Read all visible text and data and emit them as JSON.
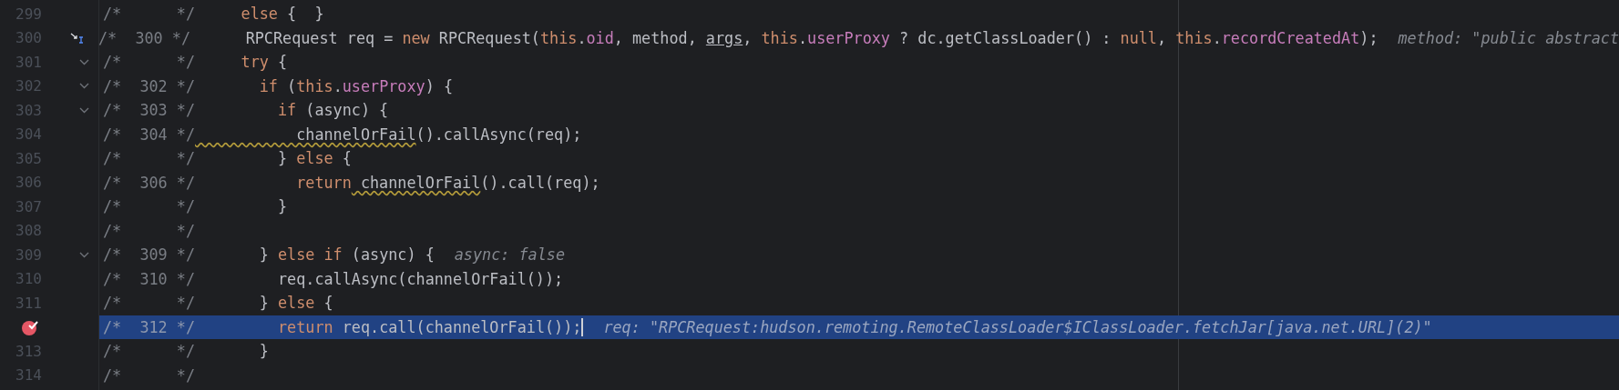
{
  "editor": {
    "rows": [
      {
        "number": "299",
        "foldable": false,
        "stepping": false,
        "breakpoint": false,
        "selected": false,
        "caret": false,
        "prefix": "/*      */",
        "code": [
          {
            "t": "     else",
            "kind": "keyword"
          },
          {
            "t": " {  }",
            "kind": "plain"
          }
        ]
      },
      {
        "number": "300",
        "foldable": false,
        "stepping": true,
        "breakpoint": false,
        "selected": false,
        "caret": false,
        "prefix": "/*  300 */",
        "code": [
          {
            "t": "      RPCRequest req = ",
            "kind": "plain"
          },
          {
            "t": "new",
            "kind": "keyword"
          },
          {
            "t": " RPCRequest(",
            "kind": "plain"
          },
          {
            "t": "this",
            "kind": "keyword"
          },
          {
            "t": ".",
            "kind": "plain"
          },
          {
            "t": "oid",
            "kind": "field"
          },
          {
            "t": ", method, ",
            "kind": "plain"
          },
          {
            "t": "args",
            "kind": "underlined"
          },
          {
            "t": ", ",
            "kind": "plain"
          },
          {
            "t": "this",
            "kind": "keyword"
          },
          {
            "t": ".",
            "kind": "plain"
          },
          {
            "t": "userProxy",
            "kind": "field"
          },
          {
            "t": " ? dc.getClassLoader() : ",
            "kind": "plain"
          },
          {
            "t": "null",
            "kind": "keyword"
          },
          {
            "t": ", ",
            "kind": "plain"
          },
          {
            "t": "this",
            "kind": "keyword"
          },
          {
            "t": ".",
            "kind": "plain"
          },
          {
            "t": "recordCreatedAt",
            "kind": "field"
          },
          {
            "t": ");",
            "kind": "plain"
          }
        ],
        "hint": "method: \"public abstract"
      },
      {
        "number": "301",
        "foldable": true,
        "stepping": false,
        "breakpoint": false,
        "selected": false,
        "caret": false,
        "prefix": "/*      */",
        "code": [
          {
            "t": "     try",
            "kind": "keyword"
          },
          {
            "t": " {",
            "kind": "plain"
          }
        ]
      },
      {
        "number": "302",
        "foldable": true,
        "stepping": false,
        "breakpoint": false,
        "selected": false,
        "caret": false,
        "prefix": "/*  302 */",
        "code": [
          {
            "t": "       if",
            "kind": "keyword"
          },
          {
            "t": " (",
            "kind": "plain"
          },
          {
            "t": "this",
            "kind": "keyword"
          },
          {
            "t": ".",
            "kind": "plain"
          },
          {
            "t": "userProxy",
            "kind": "field"
          },
          {
            "t": ") {",
            "kind": "plain"
          }
        ]
      },
      {
        "number": "303",
        "foldable": true,
        "stepping": false,
        "breakpoint": false,
        "selected": false,
        "caret": false,
        "prefix": "/*  303 */",
        "code": [
          {
            "t": "         if",
            "kind": "keyword"
          },
          {
            "t": " (async) {",
            "kind": "plain"
          }
        ]
      },
      {
        "number": "304",
        "foldable": false,
        "stepping": false,
        "breakpoint": false,
        "selected": false,
        "caret": false,
        "prefix": "/*  304 */",
        "code": [
          {
            "t": "           channelOrFail",
            "kind": "warning"
          },
          {
            "t": "().callAsync(req);",
            "kind": "plain"
          }
        ]
      },
      {
        "number": "305",
        "foldable": false,
        "stepping": false,
        "breakpoint": false,
        "selected": false,
        "caret": false,
        "prefix": "/*      */",
        "code": [
          {
            "t": "         } ",
            "kind": "plain"
          },
          {
            "t": "else",
            "kind": "keyword"
          },
          {
            "t": " {",
            "kind": "plain"
          }
        ]
      },
      {
        "number": "306",
        "foldable": false,
        "stepping": false,
        "breakpoint": false,
        "selected": false,
        "caret": false,
        "prefix": "/*  306 */",
        "code": [
          {
            "t": "           return",
            "kind": "keyword"
          },
          {
            "t": " channelOrFail",
            "kind": "warning"
          },
          {
            "t": "().call(req);",
            "kind": "plain"
          }
        ]
      },
      {
        "number": "307",
        "foldable": false,
        "stepping": false,
        "breakpoint": false,
        "selected": false,
        "caret": false,
        "prefix": "/*      */",
        "code": [
          {
            "t": "         }",
            "kind": "plain"
          }
        ]
      },
      {
        "number": "308",
        "foldable": false,
        "stepping": false,
        "breakpoint": false,
        "selected": false,
        "caret": false,
        "prefix": "/*      */",
        "code": []
      },
      {
        "number": "309",
        "foldable": true,
        "stepping": false,
        "breakpoint": false,
        "selected": false,
        "caret": false,
        "prefix": "/*  309 */",
        "code": [
          {
            "t": "       } ",
            "kind": "plain"
          },
          {
            "t": "else if",
            "kind": "keyword"
          },
          {
            "t": " (async) {",
            "kind": "plain"
          }
        ],
        "hint": "async: false"
      },
      {
        "number": "310",
        "foldable": false,
        "stepping": false,
        "breakpoint": false,
        "selected": false,
        "caret": false,
        "prefix": "/*  310 */",
        "code": [
          {
            "t": "         req.callAsync(channelOrFail());",
            "kind": "plain"
          }
        ]
      },
      {
        "number": "311",
        "foldable": false,
        "stepping": false,
        "breakpoint": false,
        "selected": false,
        "caret": false,
        "prefix": "/*      */",
        "code": [
          {
            "t": "       } ",
            "kind": "plain"
          },
          {
            "t": "else",
            "kind": "keyword"
          },
          {
            "t": " {",
            "kind": "plain"
          }
        ]
      },
      {
        "foldable": false,
        "stepping": false,
        "breakpoint": true,
        "selected": true,
        "caret": true,
        "prefix": "/*  312 */",
        "code": [
          {
            "t": "         return",
            "kind": "keyword"
          },
          {
            "t": " req.call(channelOrFail());",
            "kind": "plain"
          }
        ],
        "hint": "req: \"RPCRequest:hudson.remoting.RemoteClassLoader$IClassLoader.fetchJar[java.net.URL](2)\""
      },
      {
        "number": "313",
        "foldable": false,
        "stepping": false,
        "breakpoint": false,
        "selected": false,
        "caret": false,
        "prefix": "/*      */",
        "code": [
          {
            "t": "       }",
            "kind": "plain"
          }
        ]
      },
      {
        "number": "314",
        "foldable": false,
        "stepping": false,
        "breakpoint": false,
        "selected": false,
        "caret": false,
        "prefix": "/*      */",
        "code": []
      }
    ]
  }
}
